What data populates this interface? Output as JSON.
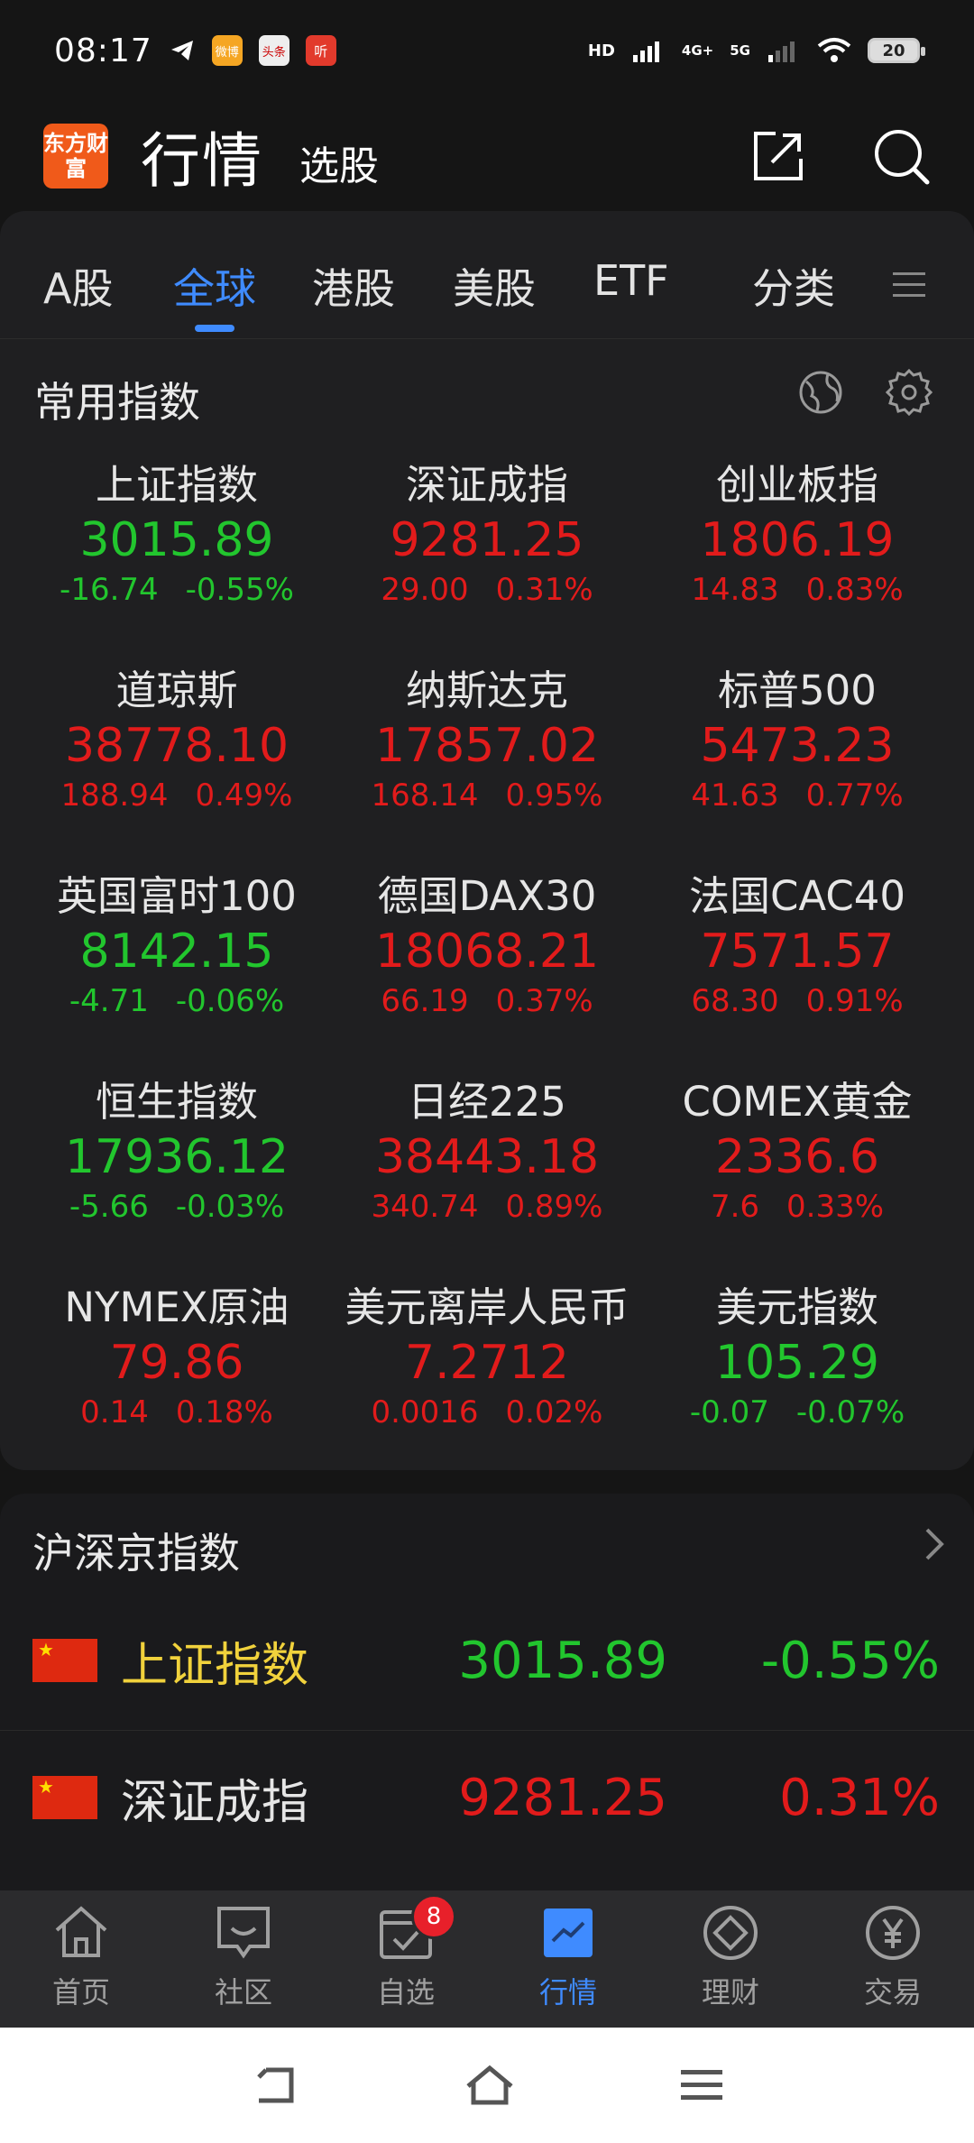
{
  "status_bar": {
    "time": "08:17",
    "app_badges": [
      "微博",
      "头条",
      "听"
    ],
    "network": [
      "HD",
      "4G+",
      "5G"
    ],
    "battery": "20"
  },
  "header": {
    "logo_text": "东方财富",
    "title": "行情",
    "subtitle": "选股"
  },
  "tabs": [
    "A股",
    "全球",
    "港股",
    "美股",
    "ETF",
    "分类"
  ],
  "active_tab": "全球",
  "common_indices": {
    "title": "常用指数",
    "items": [
      {
        "name": "上证指数",
        "price": "3015.89",
        "change": "-16.74",
        "pct": "-0.55%",
        "dir": "down"
      },
      {
        "name": "深证成指",
        "price": "9281.25",
        "change": "29.00",
        "pct": "0.31%",
        "dir": "up"
      },
      {
        "name": "创业板指",
        "price": "1806.19",
        "change": "14.83",
        "pct": "0.83%",
        "dir": "up"
      },
      {
        "name": "道琼斯",
        "price": "38778.10",
        "change": "188.94",
        "pct": "0.49%",
        "dir": "up"
      },
      {
        "name": "纳斯达克",
        "price": "17857.02",
        "change": "168.14",
        "pct": "0.95%",
        "dir": "up"
      },
      {
        "name": "标普500",
        "price": "5473.23",
        "change": "41.63",
        "pct": "0.77%",
        "dir": "up"
      },
      {
        "name": "英国富时100",
        "price": "8142.15",
        "change": "-4.71",
        "pct": "-0.06%",
        "dir": "down"
      },
      {
        "name": "德国DAX30",
        "price": "18068.21",
        "change": "66.19",
        "pct": "0.37%",
        "dir": "up"
      },
      {
        "name": "法国CAC40",
        "price": "7571.57",
        "change": "68.30",
        "pct": "0.91%",
        "dir": "up"
      },
      {
        "name": "恒生指数",
        "price": "17936.12",
        "change": "-5.66",
        "pct": "-0.03%",
        "dir": "down"
      },
      {
        "name": "日经225",
        "price": "38443.18",
        "change": "340.74",
        "pct": "0.89%",
        "dir": "up"
      },
      {
        "name": "COMEX黄金",
        "price": "2336.6",
        "change": "7.6",
        "pct": "0.33%",
        "dir": "up"
      },
      {
        "name": "NYMEX原油",
        "price": "79.86",
        "change": "0.14",
        "pct": "0.18%",
        "dir": "up"
      },
      {
        "name": "美元离岸人民币",
        "price": "7.2712",
        "change": "0.0016",
        "pct": "0.02%",
        "dir": "up"
      },
      {
        "name": "美元指数",
        "price": "105.29",
        "change": "-0.07",
        "pct": "-0.07%",
        "dir": "down"
      }
    ]
  },
  "hsj_indices": {
    "title": "沪深京指数",
    "rows": [
      {
        "name": "上证指数",
        "price": "3015.89",
        "pct": "-0.55%",
        "dir": "down",
        "name_color": "#f1d23c"
      },
      {
        "name": "深证成指",
        "price": "9281.25",
        "pct": "0.31%",
        "dir": "up",
        "name_color": "#e6e6e6"
      }
    ]
  },
  "bottom_nav": [
    {
      "label": "首页",
      "icon": "home-icon"
    },
    {
      "label": "社区",
      "icon": "community-icon"
    },
    {
      "label": "自选",
      "icon": "watchlist-icon",
      "badge": "8"
    },
    {
      "label": "行情",
      "icon": "market-icon"
    },
    {
      "label": "理财",
      "icon": "wealth-icon"
    },
    {
      "label": "交易",
      "icon": "trade-icon"
    }
  ],
  "colors": {
    "up": "#e21b1b",
    "down": "#22c62e",
    "accent": "#3f8bff",
    "brand": "#f05a1a"
  }
}
